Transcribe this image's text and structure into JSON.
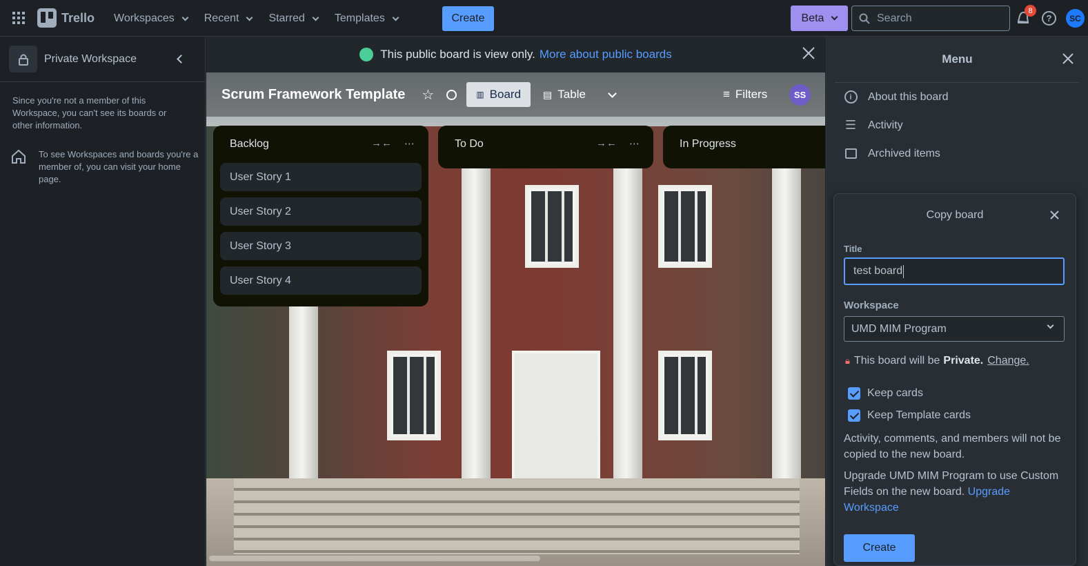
{
  "topbar": {
    "app_name": "Trello",
    "nav": [
      "Workspaces",
      "Recent",
      "Starred",
      "Templates"
    ],
    "create_label": "Create",
    "beta_label": "Beta",
    "search_placeholder": "Search",
    "notification_count": "8",
    "avatar_initials": "SC"
  },
  "sidebar": {
    "workspace_title": "Private Workspace",
    "notice": "Since you're not a member of this Workspace, you can't see its boards or other information.",
    "home_text": "To see Workspaces and boards you're a member of, you can visit your home page."
  },
  "banner": {
    "text": "This public board is view only.",
    "link": "More about public boards"
  },
  "board": {
    "title": "Scrum Framework Template",
    "views": [
      "Board",
      "Table"
    ],
    "filters_label": "Filters",
    "member_initials": "SS",
    "lists": [
      {
        "name": "Backlog",
        "cards": [
          "User Story 1",
          "User Story 2",
          "User Story 3",
          "User Story 4"
        ]
      },
      {
        "name": "To Do",
        "cards": []
      },
      {
        "name": "In Progress",
        "cards": []
      }
    ]
  },
  "menu": {
    "title": "Menu",
    "items": [
      "About this board",
      "Activity",
      "Archived items"
    ]
  },
  "copy_board": {
    "title": "Copy board",
    "title_label": "Title",
    "title_value": "test board",
    "workspace_label": "Workspace",
    "workspace_value": "UMD MIM Program",
    "privacy_prefix": "This board will be",
    "privacy_value": "Private.",
    "privacy_change": "Change.",
    "keep_cards": "Keep cards",
    "keep_template_cards": "Keep Template cards",
    "info_text": "Activity, comments, and members will not be copied to the new board.",
    "upgrade_text": "Upgrade UMD MIM Program to use Custom Fields on the new board.",
    "upgrade_link": "Upgrade Workspace",
    "create_label": "Create"
  },
  "colors": {
    "accent": "#579dff",
    "beta": "#9f8fef",
    "notification": "#e34935",
    "avatar": "#1d7afc"
  }
}
